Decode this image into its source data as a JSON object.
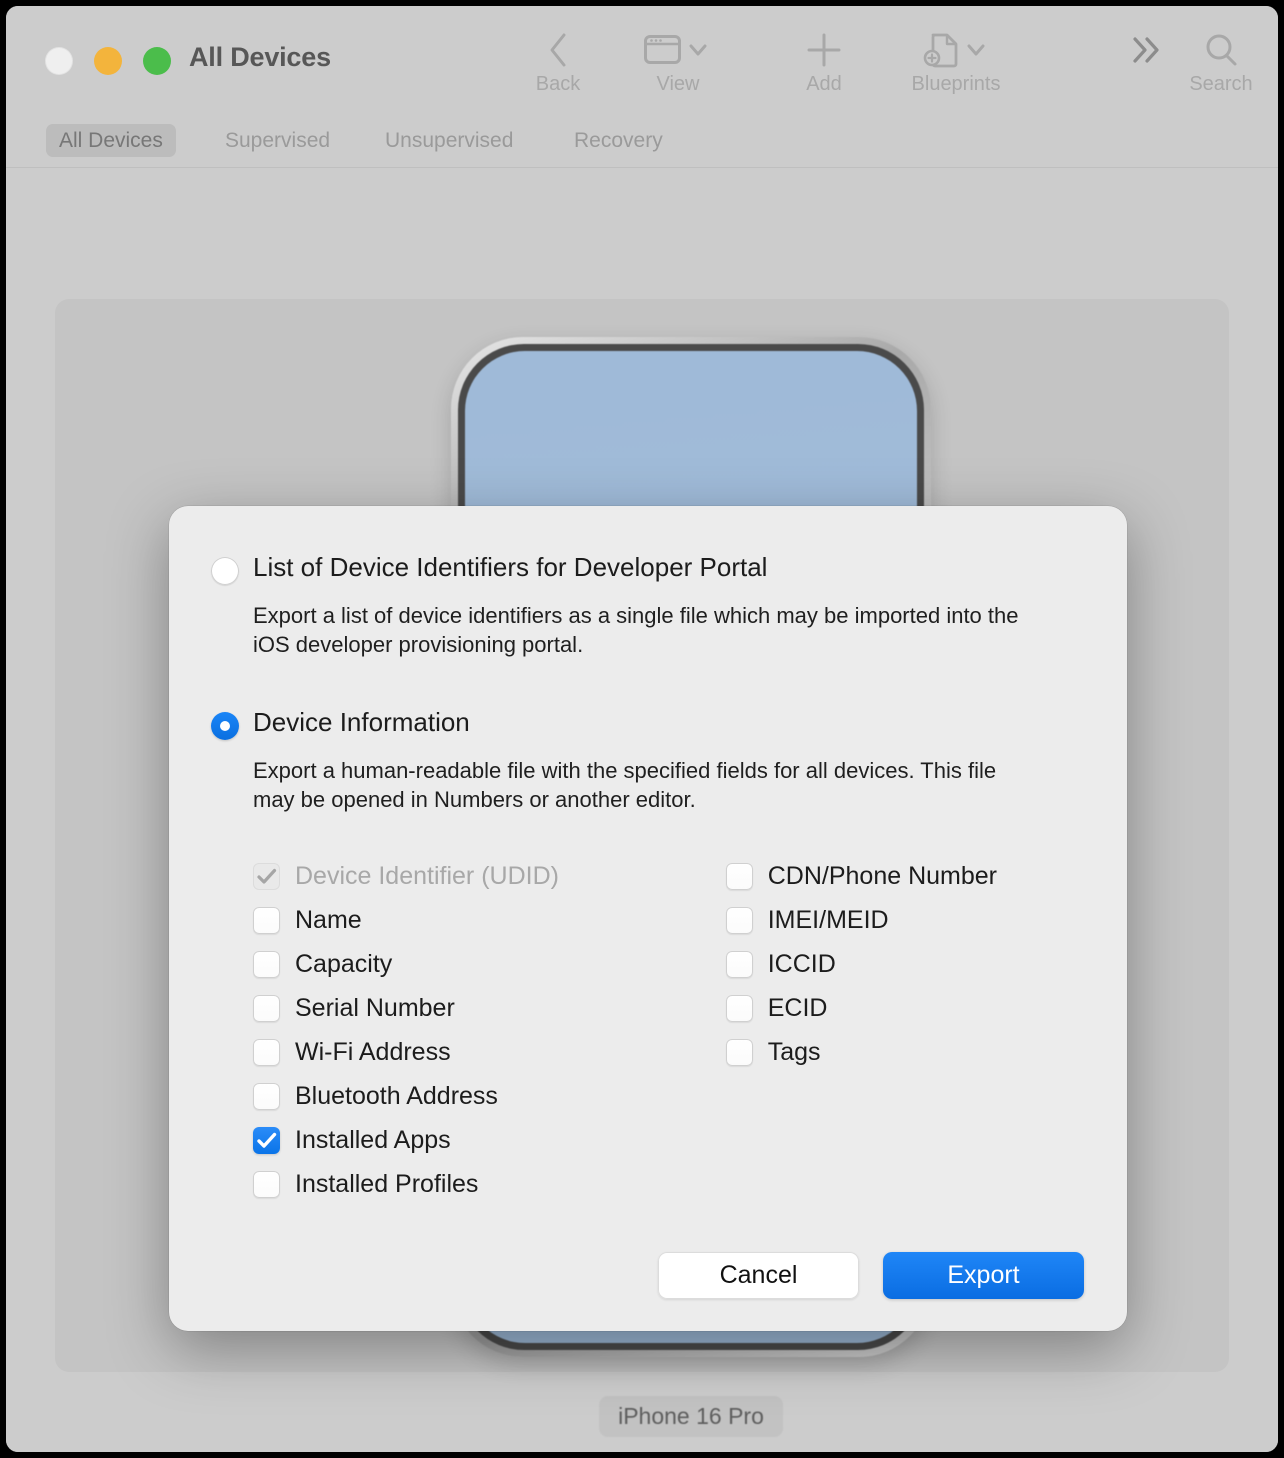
{
  "window": {
    "title": "All Devices",
    "traffic_lights": [
      {
        "name": "close",
        "color": "#efefef"
      },
      {
        "name": "minimize",
        "color": "#f3b43c"
      },
      {
        "name": "maximize",
        "color": "#4bbd4b"
      }
    ]
  },
  "toolbar": {
    "items": [
      {
        "icon": "back-chevron-icon",
        "label": "Back"
      },
      {
        "icon": "window-view-icon",
        "label": "View",
        "has_menu": true
      },
      {
        "icon": "plus-icon",
        "label": "Add"
      },
      {
        "icon": "blueprint-document-add-icon",
        "label": "Blueprints",
        "has_menu": true
      },
      {
        "icon": "double-chevron-right-icon",
        "label": ""
      },
      {
        "icon": "search-magnifier-icon",
        "label": "Search"
      }
    ]
  },
  "tabs": [
    {
      "label": "All Devices",
      "active": true
    },
    {
      "label": "Supervised",
      "active": false
    },
    {
      "label": "Unsupervised",
      "active": false
    },
    {
      "label": "Recovery",
      "active": false
    }
  ],
  "device": {
    "name_chip": "iPhone 16 Pro",
    "dock_apps": [
      "photos-app-icon",
      "safari-app-icon",
      "app-store-app-icon",
      "messages-app-icon"
    ]
  },
  "sheet": {
    "options": [
      {
        "id": "list-of-device-identifiers",
        "title": "List of Device Identifiers for Developer Portal",
        "description": "Export a list of device identifiers as a single file which may be imported into the iOS developer provisioning portal.",
        "selected": false
      },
      {
        "id": "device-information",
        "title": "Device Information",
        "description": "Export a human-readable file with the specified fields for all devices. This file may be opened in Numbers or another editor.",
        "selected": true
      }
    ],
    "fields": {
      "left_column": [
        {
          "label": "Device Identifier (UDID)",
          "checked": true,
          "enabled": false
        },
        {
          "label": "Name",
          "checked": false,
          "enabled": true
        },
        {
          "label": "Capacity",
          "checked": false,
          "enabled": true
        },
        {
          "label": "Serial Number",
          "checked": false,
          "enabled": true
        },
        {
          "label": "Wi-Fi Address",
          "checked": false,
          "enabled": true
        },
        {
          "label": "Bluetooth Address",
          "checked": false,
          "enabled": true
        },
        {
          "label": "Installed Apps",
          "checked": true,
          "enabled": true
        },
        {
          "label": "Installed Profiles",
          "checked": false,
          "enabled": true
        }
      ],
      "right_column": [
        {
          "label": "CDN/Phone Number",
          "checked": false,
          "enabled": true
        },
        {
          "label": "IMEI/MEID",
          "checked": false,
          "enabled": true
        },
        {
          "label": "ICCID",
          "checked": false,
          "enabled": true
        },
        {
          "label": "ECID",
          "checked": false,
          "enabled": true
        },
        {
          "label": "Tags",
          "checked": false,
          "enabled": true
        }
      ]
    },
    "buttons": {
      "cancel_label": "Cancel",
      "export_label": "Export"
    }
  },
  "colors": {
    "accent_blue": "#0a74e8",
    "sheet_background": "#ececec",
    "window_background": "#cccccc",
    "panel_background": "#c4c4c4",
    "disabled_text": "#a8a8a8"
  }
}
